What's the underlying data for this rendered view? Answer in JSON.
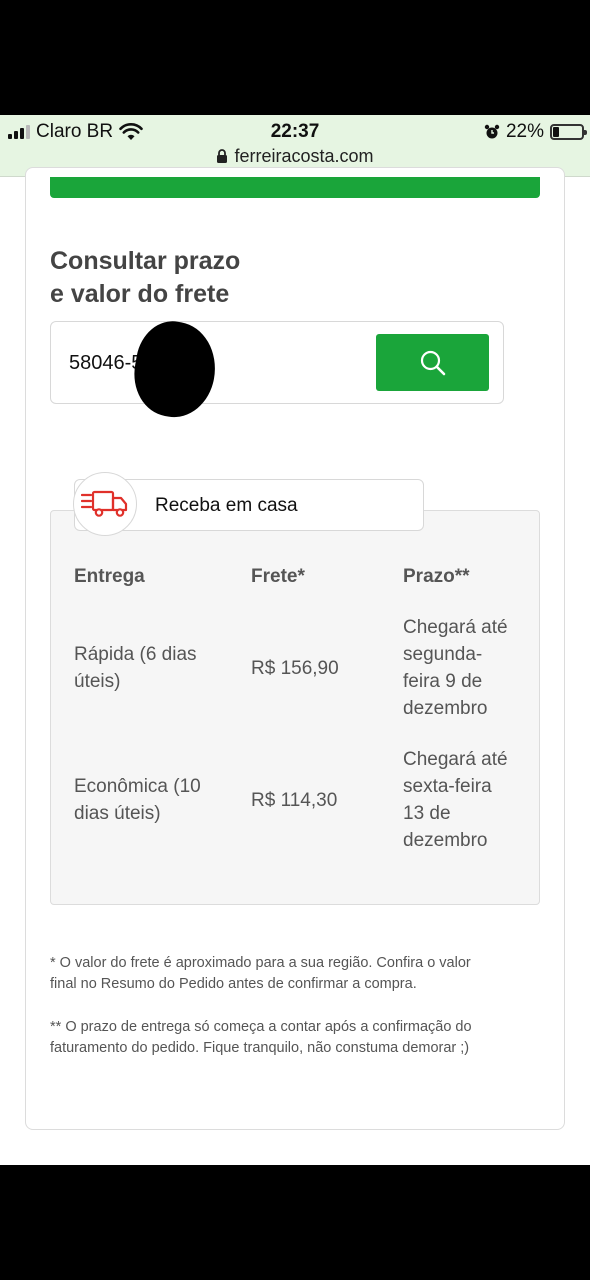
{
  "status_bar": {
    "carrier": "Claro BR",
    "time": "22:37",
    "battery_percent": "22%",
    "battery_level": 0.22,
    "url": "ferreiracosta.com"
  },
  "shipping": {
    "heading_line1": "Consultar prazo",
    "heading_line2": "e valor do frete",
    "cep_value": "58046-523",
    "tab_label": "Receba em casa",
    "columns": {
      "delivery": "Entrega",
      "price": "Frete*",
      "deadline": "Prazo**"
    },
    "rows": [
      {
        "type_line1": "Rápida (6 dias",
        "type_line2": "úteis)",
        "price": "R$ 156,90",
        "deadline_lines": [
          "Chegará até",
          "segunda-",
          "feira 9 de",
          "dezembro"
        ]
      },
      {
        "type_line1": "Econômica (10",
        "type_line2": "dias úteis)",
        "price": "R$ 114,30",
        "deadline_lines": [
          "Chegará até",
          "sexta-feira",
          "13 de",
          "dezembro"
        ]
      }
    ],
    "note_1_line1": "* O valor do frete é aproximado para a sua região. Confira o valor",
    "note_1_line2": "final no Resumo do Pedido antes de confirmar a compra.",
    "note_2_line1": "** O prazo de entrega só começa a contar após a confirmação do",
    "note_2_line2": "faturamento do pedido. Fique tranquilo, não constuma demorar ;)"
  },
  "colors": {
    "brand_green": "#1aa53a",
    "truck_red": "#e0302a"
  },
  "icons": {
    "search": "search-icon",
    "truck": "truck-icon",
    "lock": "lock-icon",
    "wifi": "wifi-icon",
    "alarm": "alarm-icon"
  }
}
